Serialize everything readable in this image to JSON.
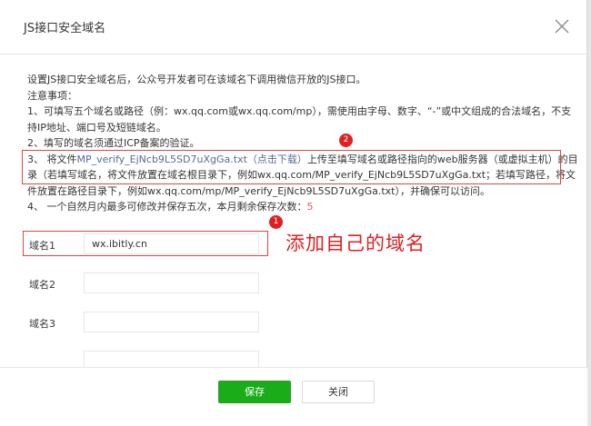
{
  "dialog": {
    "title": "JS接口安全域名"
  },
  "notes": {
    "intro": "设置JS接口安全域名后，公众号开发者可在该域名下调用微信开放的JS接口。",
    "heading": "注意事项：",
    "item1_line1": "1、可填写五个域名或路径（例：wx.qq.com或wx.qq.com/mp），需使用由字母、数字、“-”或中文组成的合法域名，不支",
    "item1_line2": "持IP地址、端口号及短链域名。",
    "item2": "2、填写的域名须通过ICP备案的验证。",
    "item3_prefix": "3、 将文件",
    "item3_file_link": "MP_verify_EjNcb9L5SD7uXgGa.txt（点击下载）",
    "item3_suffix": "上传至填写域名或路径指向的web服务器（或虚拟主机）的目",
    "item3_line2": "录（若填写域名，将文件放置在域名根目录下，例如wx.qq.com/MP_verify_EjNcb9L5SD7uXgGa.txt；若填写路径，将文",
    "item3_line3": "件放置在路径目录下，例如wx.qq.com/mp/MP_verify_EjNcb9L5SD7uXgGa.txt），并确保可以访问。",
    "item4_prefix": "4、 一个自然月内最多可修改并保存五次，本月剩余保存次数：",
    "item4_count": "5"
  },
  "badges": {
    "badge1": "1",
    "badge2": "2"
  },
  "fields": [
    {
      "label": "域名1",
      "value": "wx.ibitly.cn"
    },
    {
      "label": "域名2",
      "value": ""
    },
    {
      "label": "域名3",
      "value": ""
    }
  ],
  "annotation": "添加自己的域名",
  "footer": {
    "save_label": "保存",
    "close_label": "关闭"
  },
  "colors": {
    "primary": "#1aad19",
    "link": "#576b95",
    "annotation_red": "#e02020"
  }
}
